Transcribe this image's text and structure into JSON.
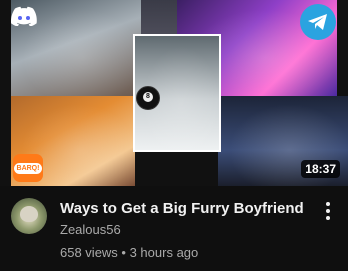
{
  "video": {
    "title": "Ways to Get a Big Furry Boyfriend",
    "channel": "Zealous56",
    "views": "658 views",
    "separator": " • ",
    "age": "3 hours ago",
    "duration": "18:37"
  },
  "thumbnail": {
    "badge_text": "BARQ!",
    "icons": [
      "discord-icon",
      "telegram-icon",
      "barq-icon",
      "8-ball-icon"
    ],
    "ball_number": "8"
  },
  "colors": {
    "background": "#0f0f0f",
    "title": "#f1f1f1",
    "secondary_text": "#aaaaaa",
    "telegram": "#2aa3e0",
    "barq": "#ff7a18",
    "discord": "#5865f2"
  }
}
